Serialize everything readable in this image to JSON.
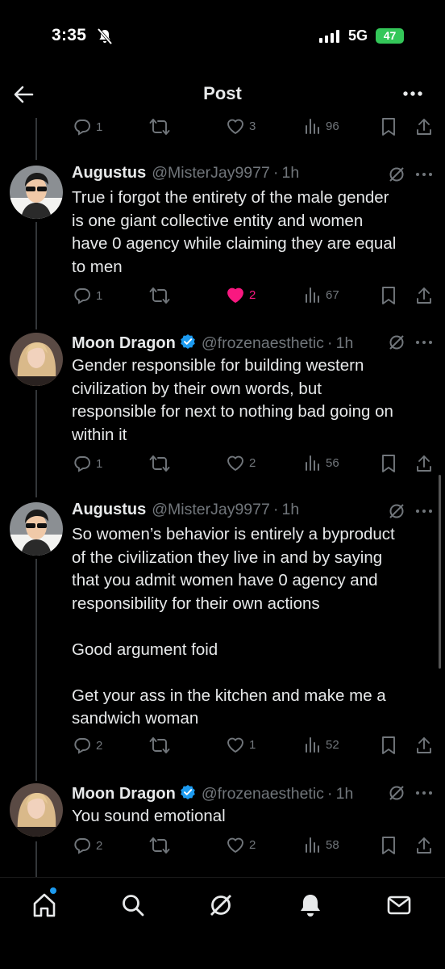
{
  "status_bar": {
    "time": "3:35",
    "network": "5G",
    "battery": "47"
  },
  "header": {
    "title": "Post"
  },
  "top_actions": {
    "replies": "1",
    "reposts": "",
    "likes": "3",
    "views": "96"
  },
  "tweets": [
    {
      "author": "Augustus",
      "handle": "@MisterJay9977",
      "time": "1h",
      "verified": false,
      "text": "True i forgot the entirety of the male gender\nis one giant collective entity and women\nhave 0 agency while claiming they are equal\nto men",
      "replies": "1",
      "likes": "2",
      "views": "67",
      "liked": true
    },
    {
      "author": "Moon Dragon",
      "handle": "@frozenaesthetic",
      "time": "1h",
      "verified": true,
      "text": "Gender responsible for building western\ncivilization by their own words, but\nresponsible for next to nothing bad going on\nwithin it",
      "replies": "1",
      "likes": "2",
      "views": "56",
      "liked": false
    },
    {
      "author": "Augustus",
      "handle": "@MisterJay9977",
      "time": "1h",
      "verified": false,
      "text": "So women’s behavior is entirely a byproduct\nof the civilization they live in and by saying\nthat you admit women have 0 agency and\nresponsibility for their own actions\n\nGood argument foid\n\nGet your ass in the kitchen and make me a\nsandwich woman",
      "replies": "2",
      "likes": "1",
      "views": "52",
      "liked": false
    },
    {
      "author": "Moon Dragon",
      "handle": "@frozenaesthetic",
      "time": "1h",
      "verified": true,
      "text": "You sound emotional",
      "replies": "2",
      "likes": "2",
      "views": "58",
      "liked": false
    }
  ],
  "tabs": [
    "home-icon",
    "search-icon",
    "grok-icon",
    "notifications-icon",
    "messages-icon"
  ],
  "colors": {
    "accent": "#1d9bf0",
    "like": "#f91880",
    "muted": "#71767b",
    "battery": "#34c759"
  }
}
